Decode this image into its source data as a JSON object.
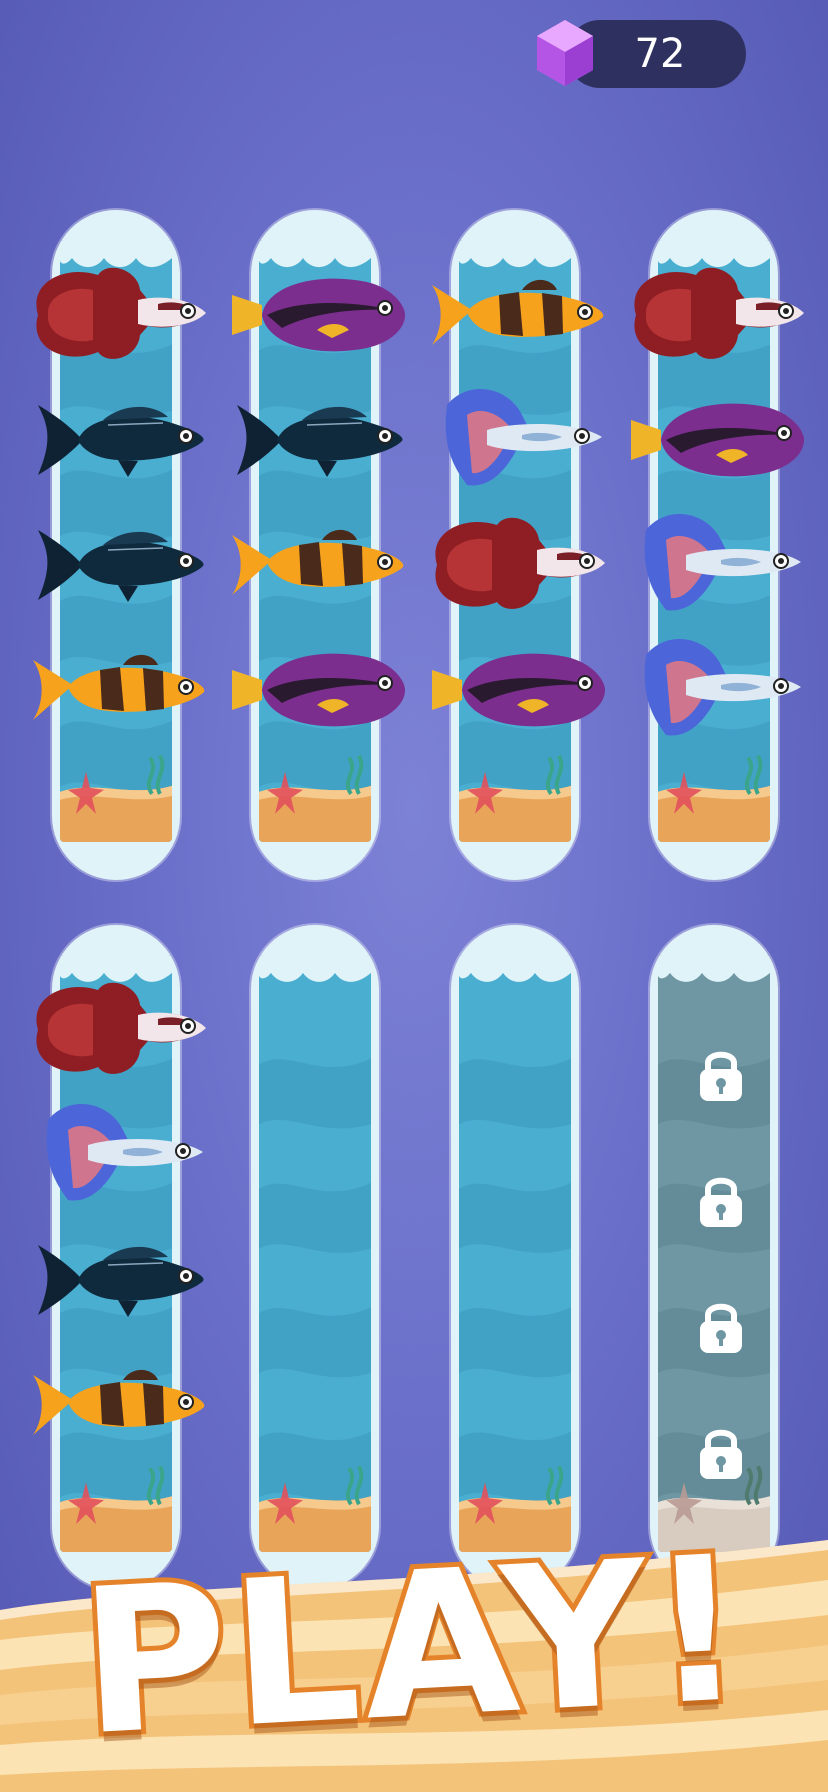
{
  "currency": {
    "icon": "gem-icon",
    "value": "72"
  },
  "board": {
    "rows": [
      {
        "tubes": [
          {
            "locked": false,
            "fish": [
              "betta-red",
              "black-fish",
              "black-fish",
              "clown-loach"
            ]
          },
          {
            "locked": false,
            "fish": [
              "purple-tang",
              "black-fish",
              "clown-loach",
              "purple-tang"
            ]
          },
          {
            "locked": false,
            "fish": [
              "clown-loach",
              "betta-blue",
              "betta-red",
              "purple-tang"
            ]
          },
          {
            "locked": false,
            "fish": [
              "betta-red",
              "purple-tang",
              "betta-blue",
              "betta-blue"
            ]
          }
        ]
      },
      {
        "tubes": [
          {
            "locked": false,
            "fish": [
              "betta-red",
              "betta-blue",
              "black-fish",
              "clown-loach"
            ]
          },
          {
            "locked": false,
            "fish": []
          },
          {
            "locked": false,
            "fish": []
          },
          {
            "locked": true,
            "fish": [],
            "slots": [
              "lock-icon",
              "lock-icon",
              "lock-icon",
              "lock-icon"
            ]
          }
        ]
      }
    ]
  },
  "play_button": {
    "label": "PLAY!"
  },
  "colors": {
    "background": "#6a6fc9",
    "water": "#4aaed1",
    "locked_water": "#6f9aa6",
    "sand": "#e8a55a",
    "accent": "#e5832a"
  }
}
